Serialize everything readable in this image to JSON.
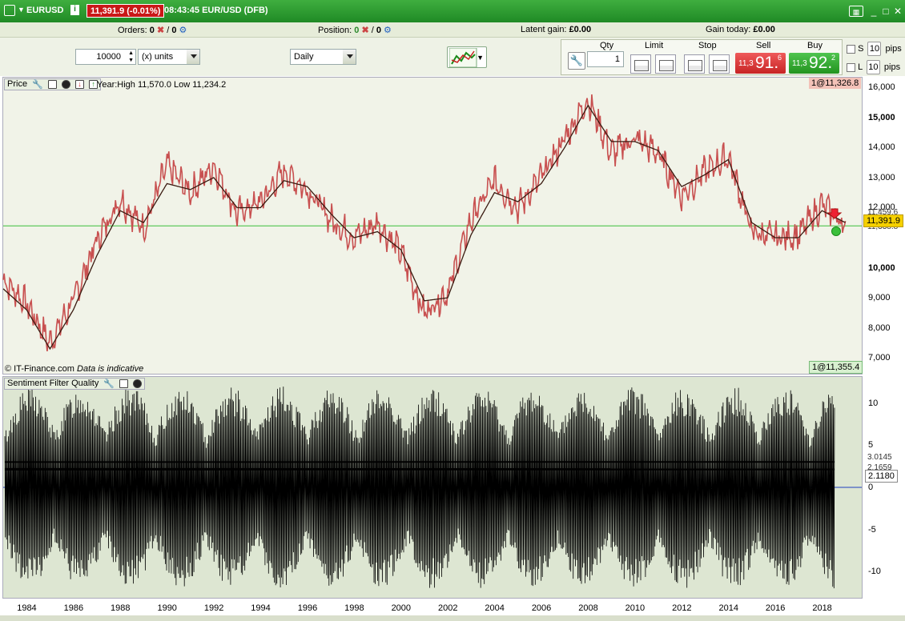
{
  "window": {
    "symbol": "EURUSD",
    "price_badge": "11,391.9 (-0.01%)",
    "time_market": "08:43:45 EUR/USD (DFB)"
  },
  "status": {
    "orders_label": "Orders:",
    "orders_value": "0",
    "orders_value2": "0",
    "position_label": "Position:",
    "position_value": "0",
    "position_value2": "0",
    "latent_gain_label": "Latent gain:",
    "latent_gain_value": "£0.00",
    "gain_today_label": "Gain today:",
    "gain_today_value": "£0.00"
  },
  "toolbar": {
    "quantity_value": "10000",
    "units_value": "(x) units",
    "timeframe_value": "Daily"
  },
  "ticket": {
    "qty_label": "Qty",
    "qty_value": "1",
    "limit_label": "Limit",
    "stop_label": "Stop",
    "sell_label": "Sell",
    "buy_label": "Buy",
    "sell_small": "11,3",
    "sell_big": "91.",
    "sell_sup": "6",
    "buy_small": "11,3",
    "buy_big": "92.",
    "buy_sup": "2",
    "stop_check_label": "S",
    "limit_check_label": "L",
    "stop_pips": "10",
    "limit_pips": "10",
    "pips_label": "pips"
  },
  "price_panel": {
    "title": "Price",
    "year_hl": "Year:High 11,570.0 Low 11,234.2",
    "top_tag": "1@11,326.8",
    "bottom_tag": "1@11,355.4",
    "current_tag": "11,391.9",
    "overlap_tag_1": "11,459.6",
    "overlap_tag_2": "11,338.8",
    "copyright": "© IT-Finance.com",
    "disclaimer": "Data is indicative",
    "y_ticks": [
      "16,000",
      "15,000",
      "14,000",
      "13,000",
      "12,000",
      "10,000",
      "9,000",
      "8,000",
      "7,000"
    ]
  },
  "indicator_panel": {
    "title": "Sentiment Filter Quality",
    "y_ticks": [
      "10",
      "5",
      "0",
      "-5",
      "-10"
    ],
    "tag_1": "3.0145",
    "tag_2": "2.1659",
    "tag_3": "2.1180"
  },
  "x_ticks": [
    "1984",
    "1986",
    "1988",
    "1990",
    "1992",
    "1994",
    "1996",
    "1998",
    "2000",
    "2002",
    "2004",
    "2006",
    "2008",
    "2010",
    "2012",
    "2014",
    "2016",
    "2018"
  ],
  "colors": {
    "brand_green": "#1f8a25",
    "sell_red": "#c72424",
    "buy_green": "#23931f",
    "price_line": "#c85050",
    "average_line": "#3a1a10",
    "current_level": "#3bbf3b",
    "zero_line": "#2040c0"
  },
  "chart_data": [
    {
      "type": "line",
      "title": "Price",
      "x": [
        1983,
        1984,
        1985,
        1986,
        1987,
        1988,
        1989,
        1990,
        1991,
        1992,
        1993,
        1994,
        1995,
        1996,
        1997,
        1998,
        1999,
        2000,
        2001,
        2002,
        2003,
        2004,
        2005,
        2006,
        2007,
        2008,
        2009,
        2010,
        2011,
        2012,
        2013,
        2014,
        2015,
        2016,
        2017,
        2018,
        2019
      ],
      "series": [
        {
          "name": "",
          "values": [
            9600,
            8800,
            7500,
            8900,
            10900,
            12300,
            11300,
            13400,
            12500,
            13400,
            11800,
            12200,
            13200,
            12600,
            11600,
            11000,
            11500,
            10500,
            8500,
            9200,
            11600,
            12900,
            12000,
            13000,
            14300,
            15600,
            13800,
            14300,
            13800,
            12400,
            13200,
            13700,
            11200,
            11000,
            11100,
            12100,
            11400
          ]
        },
        {
          "name": "",
          "values": [
            9300,
            8600,
            7300,
            8600,
            10400,
            11900,
            11500,
            12800,
            12600,
            13000,
            12000,
            12000,
            12900,
            12700,
            11800,
            11000,
            11200,
            10600,
            8900,
            9000,
            11100,
            12500,
            12200,
            12800,
            14000,
            15400,
            14200,
            14200,
            13900,
            12700,
            13100,
            13600,
            11500,
            11000,
            11000,
            11900,
            11500
          ]
        }
      ],
      "ylim": [
        6500,
        16300
      ],
      "ylabel": "",
      "xlabel": ""
    },
    {
      "type": "line",
      "title": "Sentiment Filter Quality",
      "ylim": [
        -13,
        13
      ],
      "series": [
        {
          "name": "",
          "min": -12,
          "max": 12
        },
        {
          "name": "",
          "values": [
            3.0,
            3.0145
          ]
        },
        {
          "name": "",
          "values": [
            2.2,
            2.1659
          ]
        },
        {
          "name": "",
          "values": [
            2.1,
            2.118
          ]
        },
        {
          "name": "",
          "values": [
            0,
            0
          ]
        }
      ]
    }
  ]
}
